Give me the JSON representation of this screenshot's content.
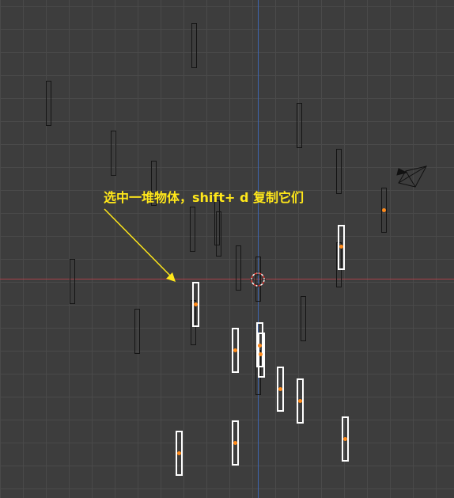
{
  "viewport": {
    "grid_color": "#4a4a4a",
    "background_color": "#3d3d3d",
    "x_axis_color": "#a8414a",
    "y_axis_color": "#3f66b1"
  },
  "annotation": {
    "text": "选中一堆物体，shift+ d 复制它们",
    "color": "#ffe71a",
    "arrow_icon": "arrow-icon"
  },
  "scene": {
    "unselected_object_count": 20,
    "selected_object_count": 11,
    "selection_color": "#ffffff",
    "origin_color": "#ff8a1a",
    "cursor_icon": "3d-cursor-icon",
    "camera_icon": "camera-icon"
  }
}
